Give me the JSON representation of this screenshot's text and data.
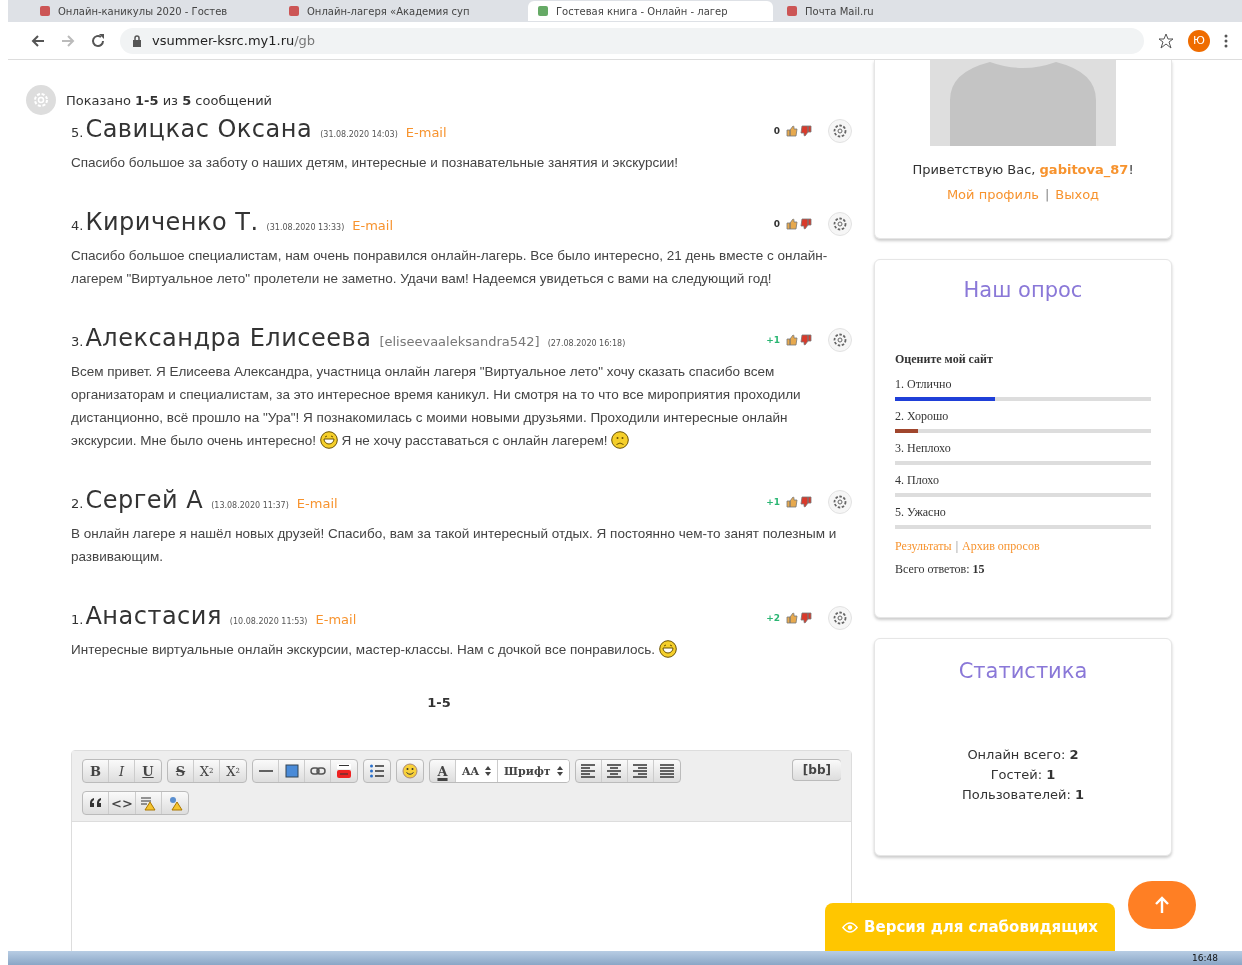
{
  "browser": {
    "tabs": [
      {
        "title": "Онлайн-каникулы 2020 - Гостев",
        "selected": false
      },
      {
        "title": "Онлайн-лагеря «Академия суп",
        "selected": false
      },
      {
        "title": "Гостевая книга - Онлайн - лагер",
        "selected": true
      },
      {
        "title": "Почта Mail.ru",
        "selected": false
      }
    ],
    "url_host": "vsummer-ksrc.my1.ru",
    "url_path": "/gb",
    "profile_letter": "Ю"
  },
  "summary": "Показано **1-5** из **5** сообщений",
  "comments": [
    {
      "number": "5.",
      "author": "Савицкас Оксана",
      "date": "(31.08.2020 14:03)",
      "kind": "email",
      "contact": "E-mail",
      "rating": {
        "text": "0",
        "color": "#333333"
      },
      "body": [
        {
          "kind": "text",
          "text": "Спасибо большое за заботу о наших детям, интересные и познавательные занятия и экскурсии!"
        }
      ]
    },
    {
      "number": "4.",
      "author": "Кириченко Т.",
      "date": "(31.08.2020 13:33)",
      "kind": "email",
      "contact": "E-mail",
      "rating": {
        "text": "0",
        "color": "#333333"
      },
      "body": [
        {
          "kind": "text",
          "text": "Спасибо большое специалистам, нам очень понравился онлайн-лагерь. Все было интересно, 21 день вместе с онлайн-лагерем \"Виртуальное лето\" пролетели не заметно. Удачи вам! Надеемся увидеться с вами на следующий год!"
        }
      ]
    },
    {
      "number": "3.",
      "author": "Александра Елисеева",
      "date": "(27.08.2020 16:18)",
      "kind": "login",
      "contact": "[eliseevaaleksandra542]",
      "rating": {
        "text": "+1",
        "color": "#2bb673"
      },
      "body": [
        {
          "kind": "text",
          "text": "Всем привет. Я Елисеева Александра, участница онлайн лагеря \"Виртуальное лето\"  хочу сказать спасибо всем организаторам и специалистам, за это интересное время каникул. Ни смотря на то что  все мироприятия проходили дистанционно, всё прошло на \"Ура\"! Я познакомилась с моими новыми друзьями. Проходили интересные онлайн экскурсии. Мне было очень интересно! "
        },
        {
          "kind": "grin"
        },
        {
          "kind": "text",
          "text": " Я  не хочу расставаться с онлайн лагерем! "
        },
        {
          "kind": "sad"
        }
      ]
    },
    {
      "number": "2.",
      "author": "Сергей А",
      "date": "(13.08.2020 11:37)",
      "kind": "email",
      "contact": "E-mail",
      "rating": {
        "text": "+1",
        "color": "#2bb673"
      },
      "body": [
        {
          "kind": "text",
          "text": "В онлайн лагере я нашёл новых друзей! Спасибо, вам за такой интересный отдых. Я постоянно чем-то занят полезным и развивающим."
        }
      ]
    },
    {
      "number": "1.",
      "author": "Анастасия",
      "date": "(10.08.2020 11:53)",
      "kind": "email",
      "contact": "E-mail",
      "rating": {
        "text": "+2",
        "color": "#2bb673"
      },
      "body": [
        {
          "kind": "text",
          "text": "Интересные виртуальные онлайн экскурсии, мастер-классы. Нам с дочкой все понравилось. "
        },
        {
          "kind": "grin"
        }
      ]
    }
  ],
  "pagination": "1-5",
  "editor": {
    "rows": [
      [
        [
          {
            "kind": "bold",
            "label": "B"
          },
          {
            "kind": "italic",
            "label": "I"
          },
          {
            "kind": "underline",
            "label": "U"
          }
        ],
        [
          {
            "kind": "strike",
            "label": "S"
          },
          {
            "kind": "sup",
            "label": "X",
            "mark": "2"
          },
          {
            "kind": "sub",
            "label": "X",
            "mark": "2"
          }
        ],
        [
          {
            "kind": "hr"
          },
          {
            "kind": "image"
          },
          {
            "kind": "link"
          },
          {
            "kind": "video"
          }
        ],
        [
          {
            "kind": "list"
          }
        ],
        [
          {
            "kind": "smile"
          }
        ],
        [
          {
            "kind": "color",
            "label": "A"
          },
          {
            "kind": "size",
            "label": "AA"
          },
          {
            "kind": "font",
            "label": "Шрифт"
          }
        ],
        [
          {
            "kind": "align-left"
          },
          {
            "kind": "align-center"
          },
          {
            "kind": "align-right"
          },
          {
            "kind": "justify"
          }
        ]
      ],
      [
        [
          {
            "kind": "quote"
          },
          {
            "kind": "code",
            "label": "<>"
          },
          {
            "kind": "spoiler"
          },
          {
            "kind": "hide"
          }
        ]
      ]
    ],
    "bb_label": "[bb]"
  },
  "sidebar": {
    "profile": {
      "greeting": "Приветствую Вас, **gabitova_87**!",
      "links": [
        "Мой профиль",
        "Выход"
      ],
      "separator": "|"
    },
    "poll": {
      "title": "Наш опрос",
      "question": "Оцените мой сайт",
      "options": [
        {
          "label": "1. Отлично",
          "level": 0.39,
          "color": "#1f3fd8"
        },
        {
          "label": "2. Хорошо",
          "level": 0.09,
          "color": "#a0462d"
        },
        {
          "label": "3. Неплохо"
        },
        {
          "label": "4. Плохо"
        },
        {
          "label": "5. Ужасно"
        }
      ],
      "links": [
        "Результаты",
        "Архив опросов"
      ],
      "separator": "|",
      "total": "Всего ответов: **15**"
    },
    "stats": {
      "title": "Статистика",
      "lines": [
        "Онлайн всего: **2**",
        "Гостей: **1**",
        "Пользователей: **1**"
      ]
    }
  },
  "accessibility_button": "Версия для слабовидящих",
  "taskbar": {
    "clock": "16:48"
  }
}
